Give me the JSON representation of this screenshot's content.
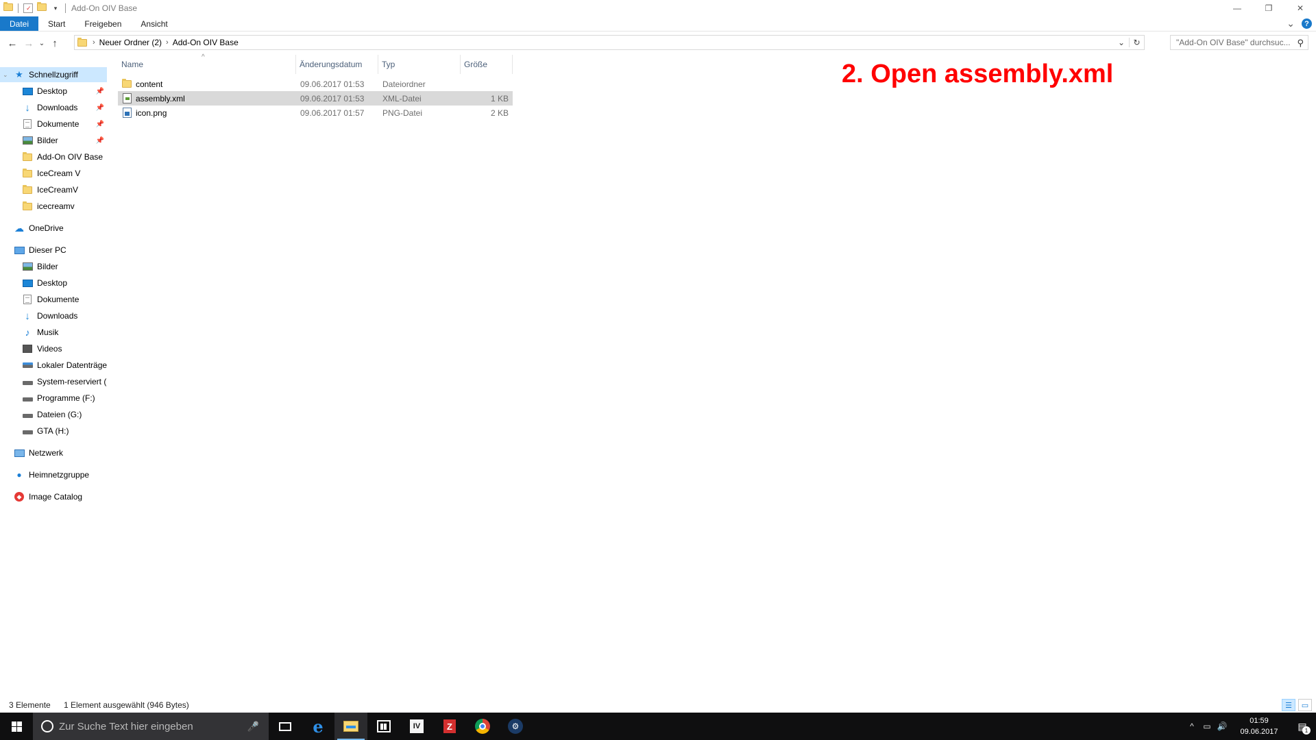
{
  "window": {
    "title": "Add-On OIV Base",
    "minimize_icon": "—",
    "restore_icon": "❐",
    "close_icon": "✕"
  },
  "ribbon": {
    "tabs": [
      {
        "label": "Datei",
        "active": true
      },
      {
        "label": "Start"
      },
      {
        "label": "Freigeben"
      },
      {
        "label": "Ansicht"
      }
    ],
    "expand_icon": "⌄",
    "help_icon": "?"
  },
  "address": {
    "breadcrumbs": [
      "Neuer Ordner (2)",
      "Add-On OIV Base"
    ],
    "search_placeholder": "\"Add-On OIV Base\" durchsuc..."
  },
  "navigation": {
    "quick_access": {
      "label": "Schnellzugriff",
      "items": [
        {
          "label": "Desktop",
          "icon": "desktop-icon",
          "pinned": true
        },
        {
          "label": "Downloads",
          "icon": "downloads-icon",
          "pinned": true
        },
        {
          "label": "Dokumente",
          "icon": "documents-icon",
          "pinned": true
        },
        {
          "label": "Bilder",
          "icon": "pictures-icon",
          "pinned": true
        },
        {
          "label": "Add-On OIV Base",
          "icon": "folder-icon"
        },
        {
          "label": "IceCream V",
          "icon": "folder-icon"
        },
        {
          "label": "IceCreamV",
          "icon": "folder-icon"
        },
        {
          "label": "icecreamv",
          "icon": "folder-icon"
        }
      ]
    },
    "onedrive": "OneDrive",
    "this_pc": {
      "label": "Dieser PC",
      "items": [
        {
          "label": "Bilder",
          "icon": "pictures-icon"
        },
        {
          "label": "Desktop",
          "icon": "desktop-icon"
        },
        {
          "label": "Dokumente",
          "icon": "documents-icon"
        },
        {
          "label": "Downloads",
          "icon": "downloads-icon"
        },
        {
          "label": "Musik",
          "icon": "music-icon"
        },
        {
          "label": "Videos",
          "icon": "videos-icon"
        },
        {
          "label": "Lokaler Datenträger",
          "icon": "system-drive-icon"
        },
        {
          "label": "System-reserviert (E",
          "icon": "drive-icon"
        },
        {
          "label": "Programme (F:)",
          "icon": "drive-icon"
        },
        {
          "label": "Dateien (G:)",
          "icon": "drive-icon"
        },
        {
          "label": "GTA (H:)",
          "icon": "drive-icon"
        }
      ]
    },
    "network": "Netzwerk",
    "homegroup": "Heimnetzgruppe",
    "image_catalog": "Image Catalog"
  },
  "file_list": {
    "columns": {
      "name": "Name",
      "date": "Änderungsdatum",
      "type": "Typ",
      "size": "Größe"
    },
    "rows": [
      {
        "name": "content",
        "date": "09.06.2017 01:53",
        "type": "Dateiordner",
        "size": "",
        "icon": "folder-icon",
        "selected": false
      },
      {
        "name": "assembly.xml",
        "date": "09.06.2017 01:53",
        "type": "XML-Datei",
        "size": "1 KB",
        "icon": "xml-file-icon",
        "selected": true
      },
      {
        "name": "icon.png",
        "date": "09.06.2017 01:57",
        "type": "PNG-Datei",
        "size": "2 KB",
        "icon": "png-file-icon",
        "selected": false
      }
    ]
  },
  "annotation": "2. Open assembly.xml",
  "status": {
    "count": "3 Elemente",
    "selection": "1 Element ausgewählt (946 Bytes)"
  },
  "taskbar": {
    "search_placeholder": "Zur Suche Text hier eingeben",
    "clock_time": "01:59",
    "clock_date": "09.06.2017",
    "notification_count": "1"
  },
  "colors": {
    "accent": "#1979ca",
    "annotation": "#ff0000",
    "taskbar": "#0f0f10",
    "selection": "#d9d9d9",
    "nav_selection": "#cce8ff"
  }
}
